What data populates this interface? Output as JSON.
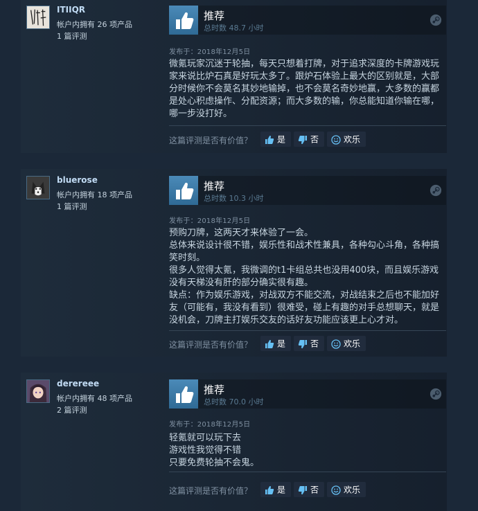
{
  "reviews": [
    {
      "author": {
        "name": "ITIIQR",
        "products": "帐户内拥有 26 项产品",
        "reviews": "1 篇评测",
        "avatar": "calligraphy-avatar"
      },
      "recommendation": "推荐",
      "hours": "总时数 48.7 小时",
      "posted": "发布于：2018年12月5日",
      "lines": [
        "微氪玩家沉迷于轮抽，每天只想着打牌，对于追求深度的卡牌游戏玩",
        "家来说比炉石真是好玩太多了。跟炉石体验上最大的区别就是，大部",
        "分时候你不会莫名其妙地输掉，也不会莫名奇妙地赢，大多数的赢都",
        "是处心积虑操作、分配资源；而大多数的输，你总能知道你输在哪，",
        "哪一步没打好。"
      ],
      "helpful_question": "这篇评测是否有价值？",
      "yes": "是",
      "no": "否",
      "funny": "欢乐"
    },
    {
      "author": {
        "name": "bluerose",
        "products": "帐户内拥有 18 项产品",
        "reviews": "1 篇评测",
        "avatar": "husky-avatar"
      },
      "recommendation": "推荐",
      "hours": "总时数 10.3 小时",
      "posted": "发布于：2018年12月5日",
      "lines": [
        "预购刀牌，这两天才来体验了一会。",
        "总体来说设计很不错，娱乐性和战术性兼具，各种勾心斗角，各种搞",
        "笑时刻。",
        "很多人觉得太氪，我微调的t1卡组总共也没用400块，而且娱乐游戏",
        "没有天梯没有肝的部分确实很有趣。",
        "缺点：作为娱乐游戏，对战双方不能交流，对战结束之后也不能加好",
        "友（可能有，我没有看到）很难受，碰上有趣的对手总想聊天，就是",
        "没机会，刀牌主打娱乐交友的话好友功能应该更上心才对。"
      ],
      "helpful_question": "这篇评测是否有价值？",
      "yes": "是",
      "no": "否",
      "funny": "欢乐"
    },
    {
      "author": {
        "name": "derereee",
        "products": "帐户内拥有 48 项产品",
        "reviews": "2 篇评测",
        "avatar": "anime-girl-avatar"
      },
      "recommendation": "推荐",
      "hours": "总时数 70.0 小时",
      "posted": "发布于：2018年12月5日",
      "lines": [
        "轻氪就可以玩下去",
        "游戏性我觉得不错",
        "只要免费轮抽不会鬼。"
      ],
      "helpful_question": "这篇评测是否有价值？",
      "yes": "是",
      "no": "否",
      "funny": "欢乐"
    }
  ],
  "colors": {
    "background": "#1b2838",
    "accent": "#66c0f4",
    "thumb": "#4b8ab8"
  }
}
